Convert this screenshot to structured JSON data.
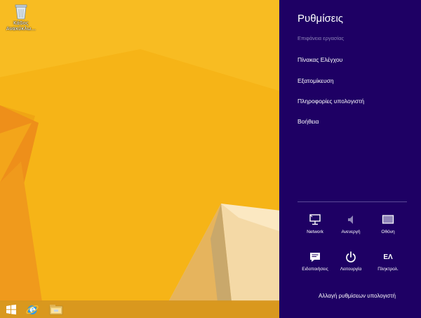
{
  "desktop": {
    "recycle_bin_label_1": "Κάδος",
    "recycle_bin_label_2": "Ανακύκλω...",
    "recycle_bin_icon": "recycle-bin-icon"
  },
  "taskbar": {
    "items": [
      {
        "name": "start-button",
        "icon": "windows-logo-icon"
      },
      {
        "name": "internet-explorer-button",
        "icon": "internet-explorer-icon"
      },
      {
        "name": "file-explorer-button",
        "icon": "folder-icon"
      }
    ]
  },
  "charms": {
    "title": "Ρυθμίσεις",
    "section": "Επιφάνεια εργασίας",
    "links": [
      "Πίνακας Ελέγχου",
      "Εξατομίκευση",
      "Πληροφορίες υπολογιστή",
      "Βοήθεια"
    ],
    "tiles": [
      {
        "label": "Network",
        "icon": "network-monitor-icon"
      },
      {
        "label": "Ανενεργή",
        "icon": "volume-icon"
      },
      {
        "label": "Οθόνη",
        "icon": "screen-icon"
      },
      {
        "label": "Ειδοποιήσεις",
        "icon": "notifications-icon"
      },
      {
        "label": "Λειτουργία",
        "icon": "power-icon"
      },
      {
        "label": "Πληκτρολ.",
        "icon_text": "ΕΛ"
      }
    ],
    "change_pc_settings": "Αλλαγή ρυθμίσεων υπολογιστή",
    "colors": {
      "panel": "#1e0064",
      "section_text": "#8d82b8",
      "wallpaper": "#f6b417"
    }
  }
}
